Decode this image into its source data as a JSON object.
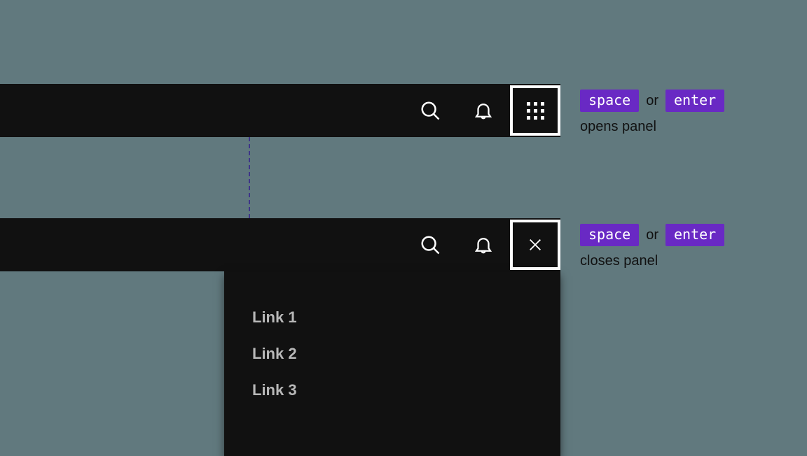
{
  "keys": {
    "space": "space",
    "or": "or",
    "enter": "enter"
  },
  "descriptions": {
    "opens": "opens panel",
    "closes": "closes panel"
  },
  "panel": {
    "links": [
      "Link 1",
      "Link 2",
      "Link 3"
    ]
  }
}
